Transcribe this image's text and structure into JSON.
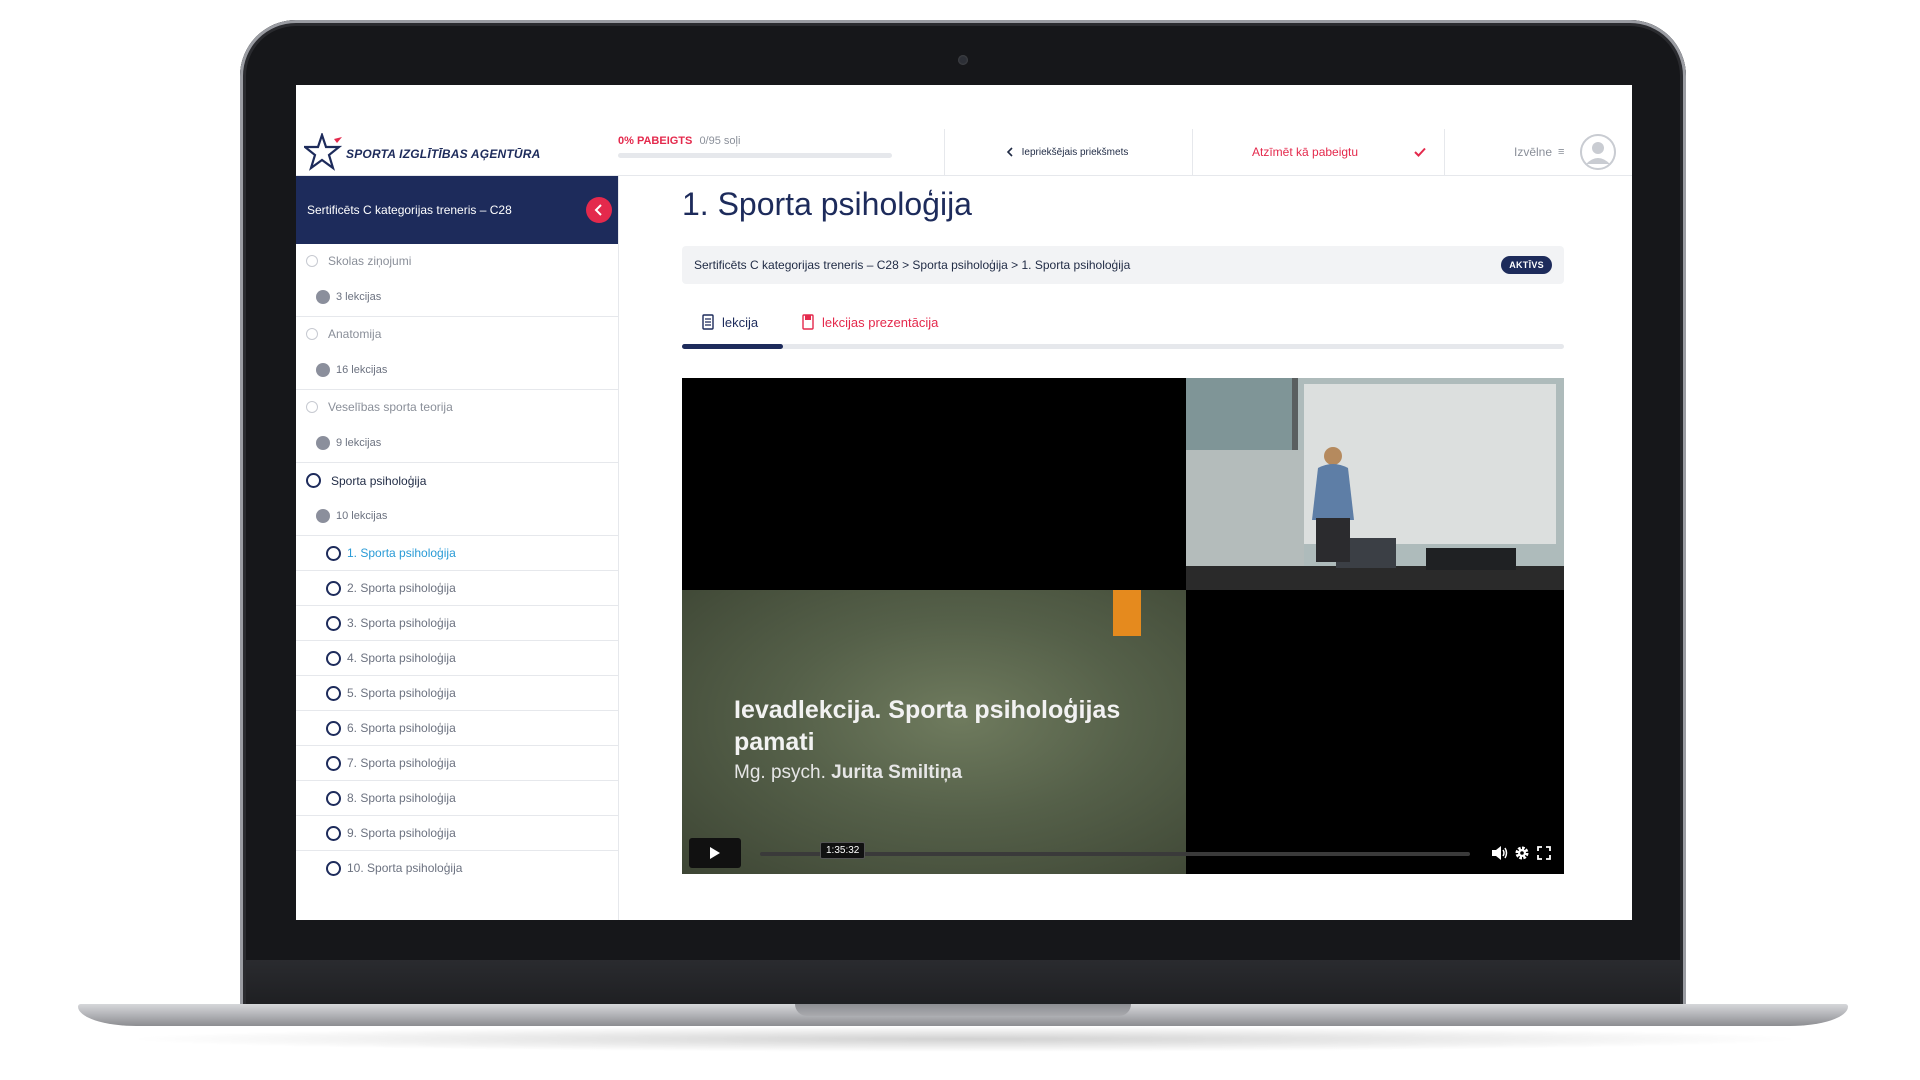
{
  "brand": {
    "name": "SPORTA IZGLĪTĪBAS AĢENTŪRA",
    "accent": "#e4294c",
    "navy": "#1d2b5b",
    "link": "#2a9bd6"
  },
  "topbar": {
    "progress_percent_label": "0% PABEIGTS",
    "progress_steps": "0/95 soļi",
    "progress_fraction": 0.0,
    "prev_label": "Iepriekšējais priekšmets",
    "mark_complete_label": "Atzīmēt kā pabeigtu",
    "menu_label": "Izvēlne"
  },
  "sidebar": {
    "course_title": "Sertificēts C kategorijas treneris – C28",
    "sections": [
      {
        "title": "Skolas ziņojumi",
        "count": "3 lekcijas",
        "active": false
      },
      {
        "title": "Anatomija",
        "count": "16 lekcijas",
        "active": false
      },
      {
        "title": "Veselības sporta teorija",
        "count": "9 lekcijas",
        "active": false
      },
      {
        "title": "Sporta psiholoģija",
        "count": "10 lekcijas",
        "active": true
      }
    ],
    "lessons": [
      "1. Sporta psiholoģija",
      "2. Sporta psiholoģija",
      "3. Sporta psiholoģija",
      "4. Sporta psiholoģija",
      "5. Sporta psiholoģija",
      "6. Sporta psiholoģija",
      "7. Sporta psiholoģija",
      "8. Sporta psiholoģija",
      "9. Sporta psiholoģija",
      "10. Sporta psiholoģija"
    ]
  },
  "main": {
    "title": "1. Sporta psiholoģija",
    "breadcrumb": "Sertificēts C kategorijas treneris – C28 > Sporta psiholoģija > 1. Sporta psiholoģija",
    "status_badge": "AKTĪVS",
    "tabs": {
      "lecture": "lekcija",
      "slides": "lekcijas prezentācija"
    }
  },
  "video": {
    "slide_title": "Ievadlekcija. Sporta psiholoģijas pamati",
    "slide_author_prefix": "Mg. psych.",
    "slide_author_name": "Jurita Smiltiņa",
    "duration_tooltip": "1:35:32",
    "icons": [
      "play-icon",
      "volume-icon",
      "settings-icon",
      "fullscreen-icon"
    ]
  }
}
